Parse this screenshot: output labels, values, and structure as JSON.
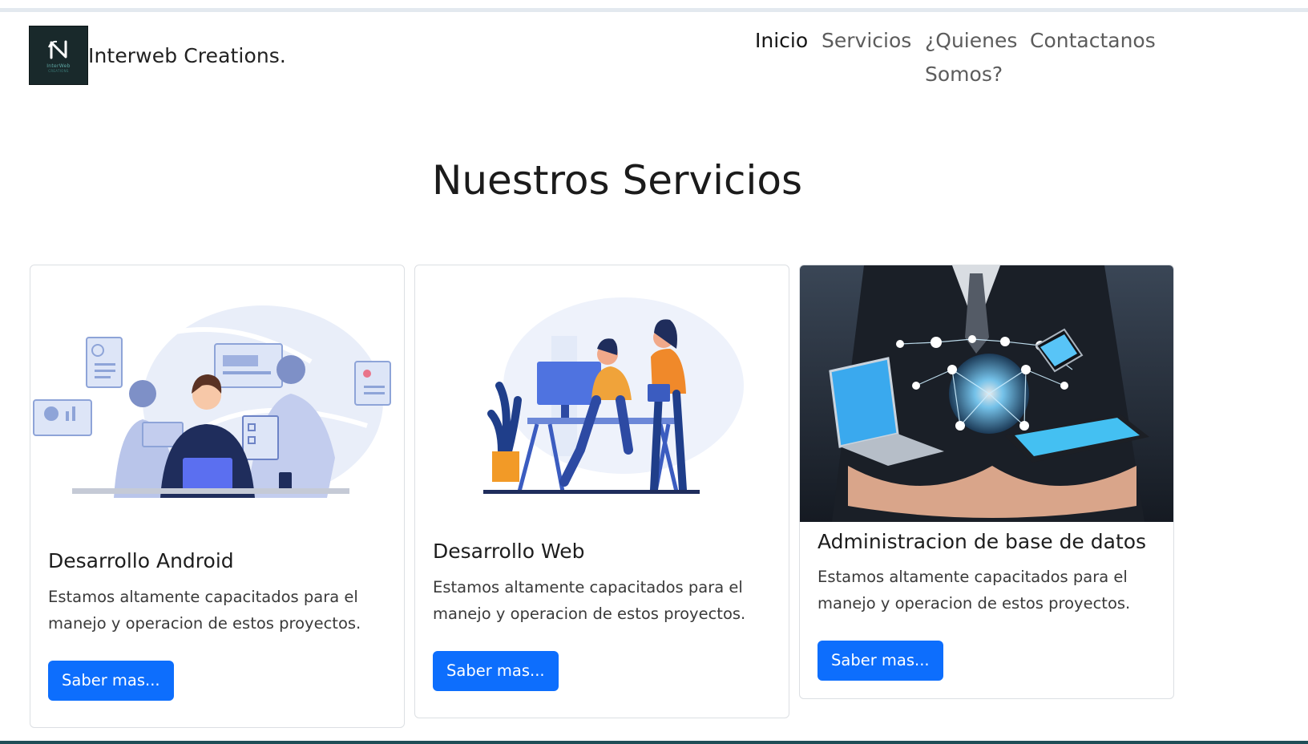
{
  "brand": {
    "logo_caption": "InterWeb",
    "logo_tagline": "CREATIONS",
    "name": "Interweb Creations."
  },
  "nav": {
    "items": [
      {
        "label": "Inicio",
        "active": true
      },
      {
        "label": "Servicios",
        "active": false
      },
      {
        "label": "¿Quienes Somos?",
        "active": false
      },
      {
        "label": "Contactanos",
        "active": false
      }
    ]
  },
  "section": {
    "title": "Nuestros Servicios"
  },
  "cards": [
    {
      "title": "Desarrollo Android",
      "text": "Estamos altamente capacitados para el manejo y operacion de estos proyectos.",
      "button": "Saber mas..."
    },
    {
      "title": "Desarrollo Web",
      "text": "Estamos altamente capacitados para el manejo y operacion de estos proyectos.",
      "button": "Saber mas..."
    },
    {
      "title": "Administracion de base de datos",
      "text": "Estamos altamente capacitados para el manejo y operacion de estos proyectos.",
      "button": "Saber mas..."
    }
  ],
  "colors": {
    "primary": "#0d6efd",
    "logo_bg": "#19292b",
    "accent_orange": "#f08a24"
  }
}
